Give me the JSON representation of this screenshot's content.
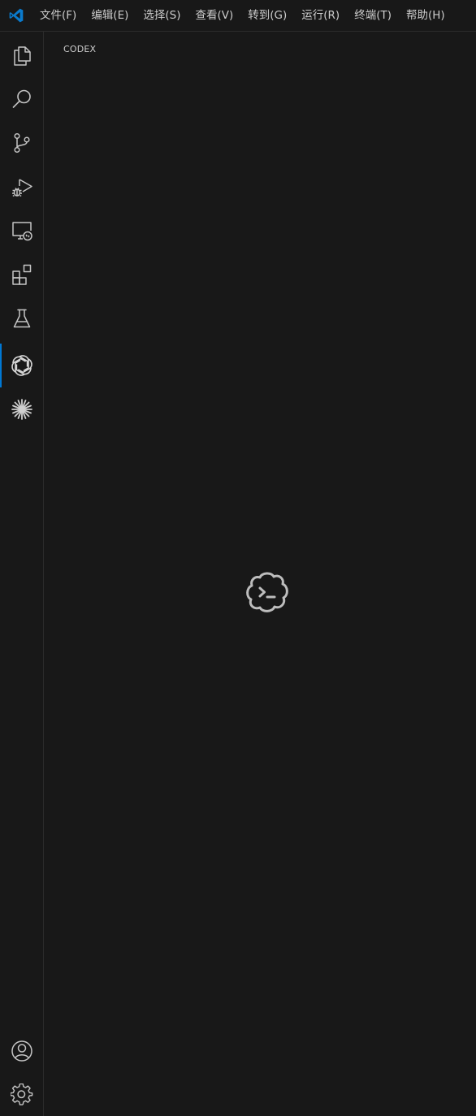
{
  "menu": {
    "items": [
      {
        "id": "file",
        "label": "文件(F)"
      },
      {
        "id": "edit",
        "label": "编辑(E)"
      },
      {
        "id": "selection",
        "label": "选择(S)"
      },
      {
        "id": "view",
        "label": "查看(V)"
      },
      {
        "id": "goto",
        "label": "转到(G)"
      },
      {
        "id": "run",
        "label": "运行(R)"
      },
      {
        "id": "terminal",
        "label": "终端(T)"
      },
      {
        "id": "help",
        "label": "帮助(H)"
      }
    ]
  },
  "activity_bar": {
    "items": [
      {
        "id": "explorer",
        "icon": "files-icon"
      },
      {
        "id": "search",
        "icon": "search-icon"
      },
      {
        "id": "source-control",
        "icon": "source-control-icon"
      },
      {
        "id": "run-debug",
        "icon": "run-debug-icon"
      },
      {
        "id": "remote-explorer",
        "icon": "remote-explorer-icon"
      },
      {
        "id": "extensions",
        "icon": "extensions-icon"
      },
      {
        "id": "testing",
        "icon": "beaker-icon"
      },
      {
        "id": "codex",
        "icon": "openai-icon",
        "active": true
      },
      {
        "id": "claude",
        "icon": "claude-spark-icon"
      }
    ],
    "bottom_items": [
      {
        "id": "accounts",
        "icon": "account-icon"
      },
      {
        "id": "manage",
        "icon": "gear-icon"
      }
    ]
  },
  "sidebar": {
    "title": "CODEX",
    "center_icon": "codex-cloud-terminal-icon"
  },
  "colors": {
    "background": "#181818",
    "border": "#2b2b2b",
    "active_indicator": "#0078d4",
    "icon": "#c5c5c5",
    "text": "#cccccc",
    "logo": "#0a7acc"
  }
}
